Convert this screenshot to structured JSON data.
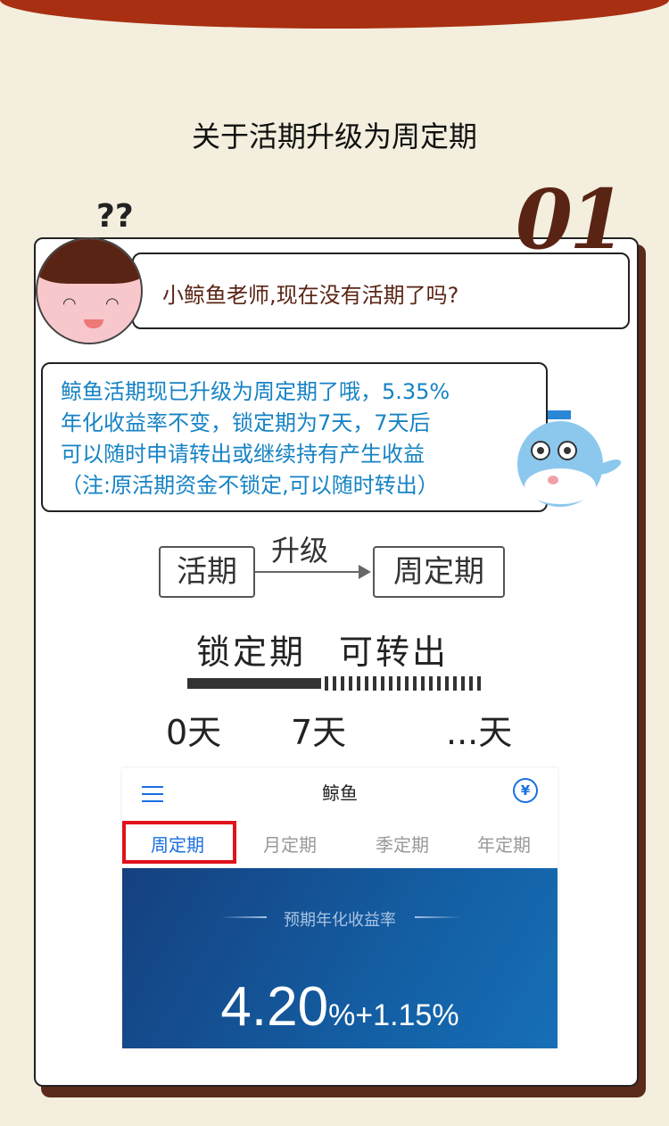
{
  "page_title": "关于活期升级为周定期",
  "section_number": "01",
  "question": "小鲸鱼老师,现在没有活期了吗?",
  "question_marks": "??",
  "answer_lines": [
    "鲸鱼活期现已升级为周定期了哦，5.35%",
    "年化收益率不变，锁定期为7天，7天后",
    "可以随时申请转出或继续持有产生收益",
    "（注:原活期资金不锁定,可以随时转出）"
  ],
  "flow": {
    "from": "活期",
    "action": "升级",
    "to": "周定期"
  },
  "timeline": {
    "locked_label": "锁定期",
    "withdraw_label": "可转出",
    "days": [
      "0天",
      "7天",
      "...天"
    ]
  },
  "app": {
    "title": "鲸鱼",
    "menu_icon": "hamburger-menu-icon",
    "wallet_icon": "yen-circle-icon",
    "wallet_glyph": "¥",
    "tabs": [
      {
        "label": "周定期",
        "active": true
      },
      {
        "label": "月定期",
        "active": false
      },
      {
        "label": "季定期",
        "active": false
      },
      {
        "label": "年定期",
        "active": false
      }
    ],
    "rate_label": "预期年化收益率",
    "rate_base": "4.20",
    "rate_bonus": "%+1.15%",
    "accent": "#1a6fe0",
    "highlight": "#e0121a"
  }
}
